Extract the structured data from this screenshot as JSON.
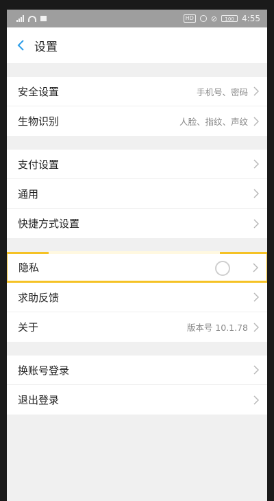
{
  "status": {
    "time": "4:55",
    "hd": "HD",
    "battery": "100"
  },
  "header": {
    "title": "设置"
  },
  "groups": [
    {
      "items": [
        {
          "label": "安全设置",
          "value": "手机号、密码"
        },
        {
          "label": "生物识别",
          "value": "人脸、指纹、声纹"
        }
      ]
    },
    {
      "items": [
        {
          "label": "支付设置",
          "value": ""
        },
        {
          "label": "通用",
          "value": ""
        },
        {
          "label": "快捷方式设置",
          "value": ""
        }
      ]
    },
    {
      "items": [
        {
          "label": "隐私",
          "value": ""
        },
        {
          "label": "求助反馈",
          "value": ""
        },
        {
          "label": "关于",
          "value": "版本号 10.1.78"
        }
      ]
    },
    {
      "items": [
        {
          "label": "换账号登录",
          "value": ""
        },
        {
          "label": "退出登录",
          "value": ""
        }
      ]
    }
  ],
  "colors": {
    "accent": "#2b9de8",
    "highlight": "#f5c225"
  }
}
